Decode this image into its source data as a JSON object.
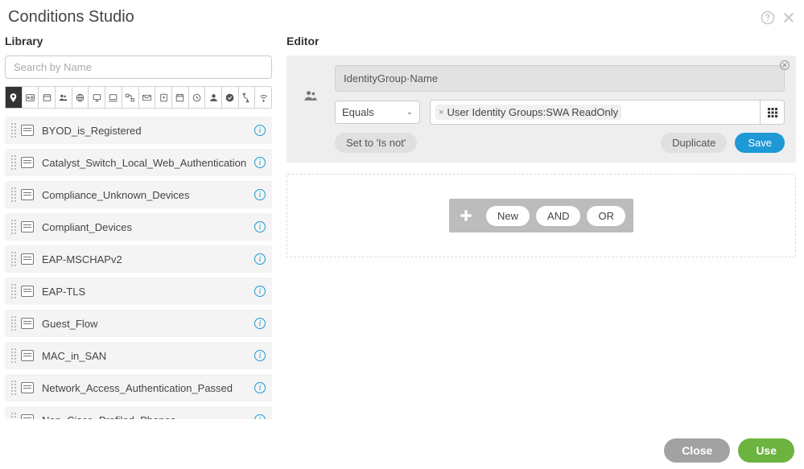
{
  "title": "Conditions Studio",
  "library": {
    "title": "Library",
    "search_placeholder": "Search by Name",
    "items": [
      {
        "name": "BYOD_is_Registered"
      },
      {
        "name": "Catalyst_Switch_Local_Web_Authentication"
      },
      {
        "name": "Compliance_Unknown_Devices"
      },
      {
        "name": "Compliant_Devices"
      },
      {
        "name": "EAP-MSCHAPv2"
      },
      {
        "name": "EAP-TLS"
      },
      {
        "name": "Guest_Flow"
      },
      {
        "name": "MAC_in_SAN"
      },
      {
        "name": "Network_Access_Authentication_Passed"
      },
      {
        "name": "Non_Cisco_Profiled_Phones"
      }
    ]
  },
  "editor": {
    "title": "Editor",
    "attribute": "IdentityGroup·Name",
    "operator": "Equals",
    "value_chip": "User Identity Groups:SWA ReadOnly",
    "set_isnot": "Set to 'Is not'",
    "duplicate": "Duplicate",
    "save": "Save",
    "new": "New",
    "and": "AND",
    "or": "OR"
  },
  "footer": {
    "close": "Close",
    "use": "Use"
  }
}
